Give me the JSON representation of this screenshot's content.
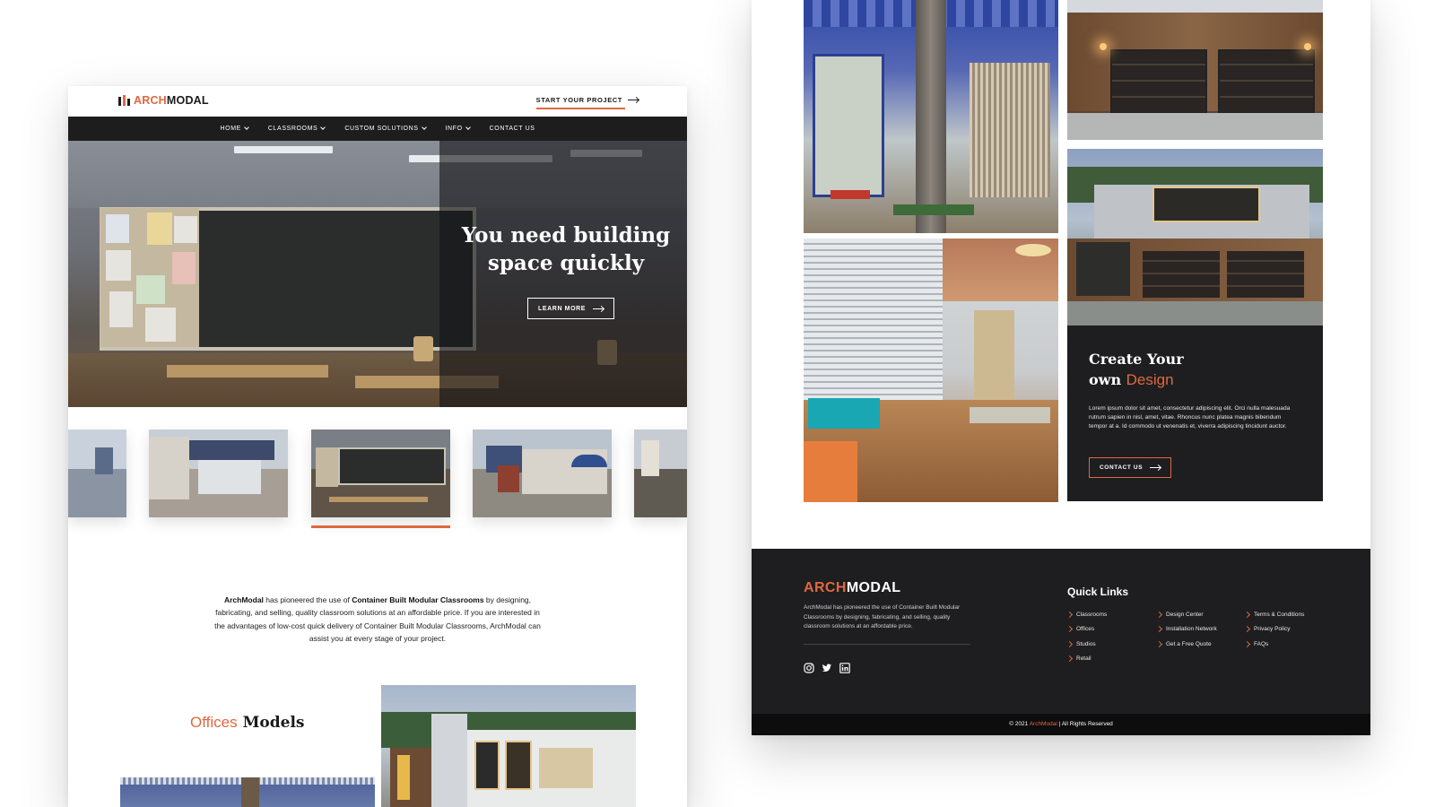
{
  "colors": {
    "accent": "#e0683f",
    "dark": "#1d1d1d",
    "footer": "#1e1e20"
  },
  "header": {
    "logo_arch": "ARCH",
    "logo_modal": "MODAL",
    "cta": "START YOUR PROJECT"
  },
  "nav": {
    "items": [
      {
        "label": "HOME",
        "dropdown": true
      },
      {
        "label": "CLASSROOMS",
        "dropdown": true
      },
      {
        "label": "CUSTOM SOLUTIONS",
        "dropdown": true
      },
      {
        "label": "INFO",
        "dropdown": true
      },
      {
        "label": "CONTACT US",
        "dropdown": false
      }
    ]
  },
  "hero": {
    "title_line1": "You need building",
    "title_line2": "space quickly",
    "button": "LEARN MORE"
  },
  "carousel": {
    "selected_index": 2,
    "count": 5
  },
  "about": {
    "brand": "ArchModal",
    "t1": " has pioneered the use of ",
    "highlight": "Container Built Modular Classrooms",
    "t2": " by designing, fabricating, and selling, quality classroom solutions at an affordable price. If you are interested in the advantages of low-cost quick delivery of Container Built Modular Classrooms, ArchModal can assist you at every stage of your project."
  },
  "models": {
    "accent_word": "Offices",
    "word": "Models"
  },
  "create": {
    "line1": "Create Your",
    "line2_prefix": "own ",
    "line2_accent": "Design",
    "body": "Lorem ipsum dolor sit amet, consectetur adipiscing elit. Orci nulla malesuada rutrum sapien in nisl, amet, vitae. Rhoncus nunc platea magnis bibendum tempor at a. Id commodo ut venenatis et, viverra adipiscing tincidunt auctor.",
    "button": "CONTACT US"
  },
  "footer": {
    "logo_arch": "ARCH",
    "logo_modal": "MODAL",
    "description": "ArchModal has pioneered the use of Container Built Modular Classrooms by designing, fabricating, and selling, quality classroom solutions at an affordable price.",
    "social": [
      "instagram-icon",
      "twitter-icon",
      "linkedin-icon"
    ],
    "quick_links_title": "Quick Links",
    "col1": [
      "Classrooms",
      "Offices",
      "Studios",
      "Retail"
    ],
    "col2": [
      "Design Center",
      "Installation Network",
      "Get a Free Quote"
    ],
    "col3": [
      "Terms & Conditions",
      "Privacy Policy",
      "FAQs"
    ],
    "copyright_prefix": "© 2021 ",
    "copyright_brand": "ArchModal",
    "copyright_suffix": " | All Rights Reserved"
  }
}
